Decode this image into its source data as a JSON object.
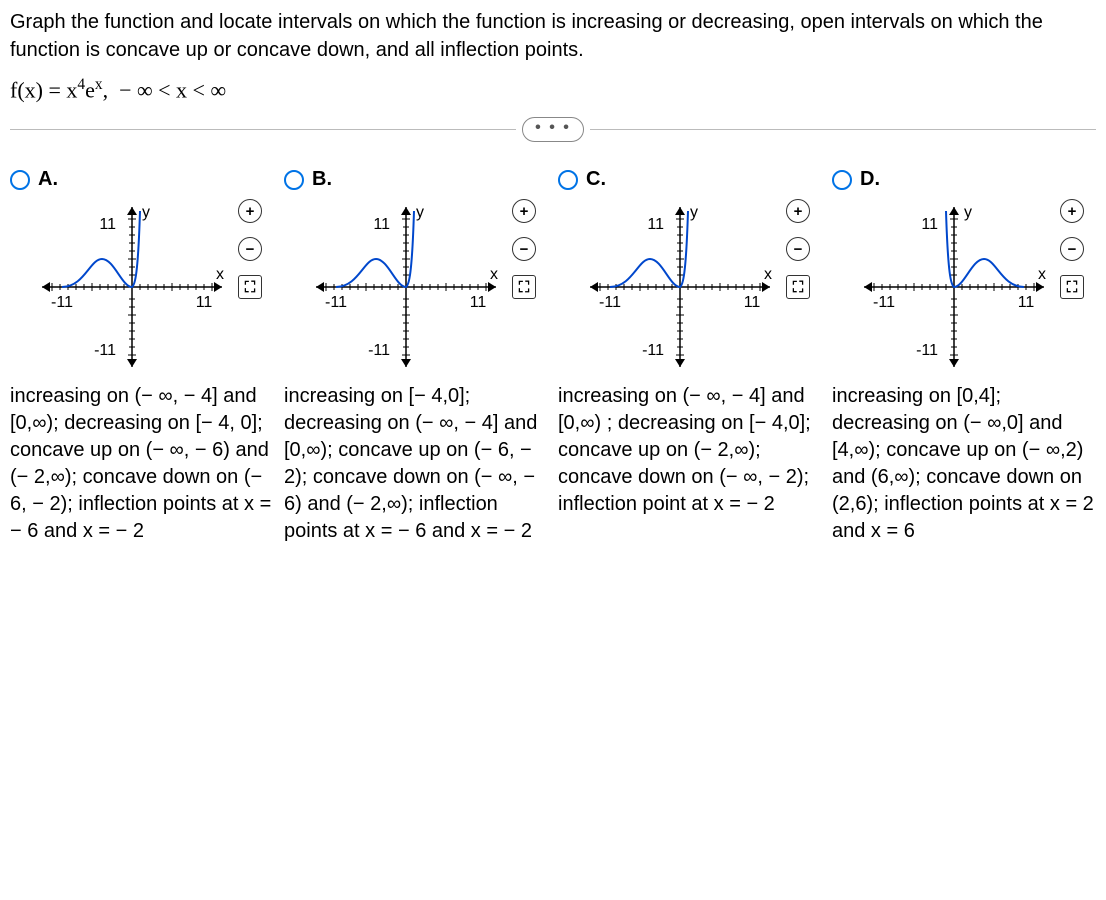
{
  "question": {
    "prompt": "Graph the function and locate intervals on which the function is increasing or decreasing, open intervals on which the function is concave up or concave down, and all inflection points.",
    "equation_html": "f(x) = x<span class='sup'>4</span>e<span class='sup'>x</span>,&nbsp;&nbsp;− ∞ < x < ∞"
  },
  "ellipsis": "• • •",
  "axes": {
    "xmin": "-11",
    "xmax": "11",
    "ymax": "11",
    "ymin": "-11",
    "xlabel": "x",
    "ylabel": "y"
  },
  "tools": {
    "zoom_in": "+",
    "zoom_out": "−",
    "expand": "⛶"
  },
  "options": [
    {
      "label": "A.",
      "curve_type": "normal",
      "desc": "increasing on (− ∞, − 4] and [0,∞); decreasing on [− 4, 0]; concave up on (− ∞, − 6) and (− 2,∞); concave down on (− 6, − 2); inflection points at x = − 6 and x = − 2"
    },
    {
      "label": "B.",
      "curve_type": "normal",
      "desc": "increasing on [− 4,0]; decreasing on (− ∞, − 4] and [0,∞); concave up on (− 6, − 2); concave down on (− ∞, − 6) and (− 2,∞); inflection points at x = − 6 and x = − 2"
    },
    {
      "label": "C.",
      "curve_type": "normal",
      "desc": "increasing on (− ∞, − 4] and [0,∞) ; decreasing on [− 4,0]; concave up on (− 2,∞); concave down on (− ∞, − 2); inflection point at x = − 2"
    },
    {
      "label": "D.",
      "curve_type": "reflected",
      "desc": "increasing on [0,4]; decreasing on (− ∞,0] and [4,∞); concave up on (− ∞,2) and (6,∞); concave down on (2,6); inflection points at x = 2 and x = 6"
    }
  ]
}
